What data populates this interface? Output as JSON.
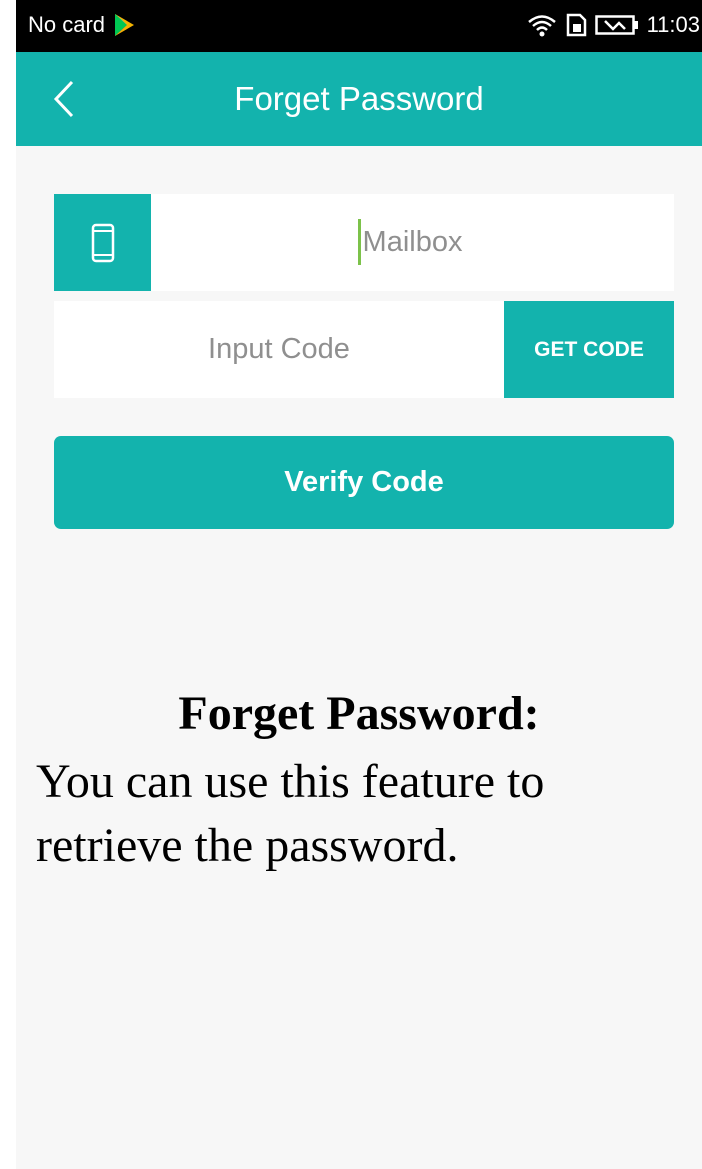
{
  "status_bar": {
    "carrier": "No card",
    "time": "11:03",
    "icons": [
      "play-store-icon",
      "wifi-icon",
      "sim-icon",
      "battery-icon"
    ]
  },
  "header": {
    "title": "Forget Password",
    "back_icon": "chevron-left-icon"
  },
  "form": {
    "mail_icon": "smartphone-icon",
    "mail_placeholder": "Mailbox",
    "code_placeholder": "Input Code",
    "get_code_label": "GET CODE",
    "verify_label": "Verify Code"
  },
  "caption": {
    "title": "Forget Password:",
    "body": "You can use this feature to retrieve the password."
  },
  "colors": {
    "accent": "#13b3ad",
    "background": "#f7f7f7",
    "status_bar": "#000000"
  }
}
